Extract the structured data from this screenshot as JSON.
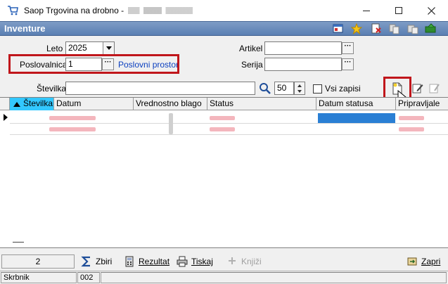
{
  "window": {
    "title": "Saop Trgovina na drobno - ",
    "minimize_label": "minimize",
    "maximize_label": "maximize",
    "close_label": "close"
  },
  "panel": {
    "title": "Inventure"
  },
  "filters": {
    "leto_label": "Leto",
    "leto_value": "2025",
    "poslovalnica_label": "Poslovalnica",
    "poslovalnica_value": "1",
    "poslovni_prostor_link": "Poslovni prostor",
    "artikel_label": "Artikel",
    "artikel_value": "",
    "serija_label": "Serija",
    "serija_value": "",
    "stevilka_label": "Številka",
    "stevilka_value": "",
    "page_size": "50",
    "vsi_zapisi_label": "Vsi zapisi"
  },
  "grid": {
    "columns": [
      "Številka",
      "Datum",
      "Vrednostno blago",
      "Status",
      "Datum statusa",
      "Pripravljale"
    ],
    "rows": [
      {
        "stevilka": "",
        "datum": "",
        "vrednostno_blago": "",
        "status": "",
        "datum_statusa": "",
        "pripravljale": ""
      }
    ]
  },
  "toolbar": {
    "count": "2",
    "zbiri": "Zbiri",
    "rezultat": "Rezultat",
    "tiskaj": "Tiskaj",
    "knjizi": "Knjiži",
    "zapri": "Zapri"
  },
  "status": {
    "user": "Skrbnik",
    "code": "002"
  },
  "colors": {
    "header_blue": "#5a7fb3",
    "highlight_red": "#c0161b",
    "active_column": "#33c8ff",
    "link_blue": "#0b3fbf"
  }
}
